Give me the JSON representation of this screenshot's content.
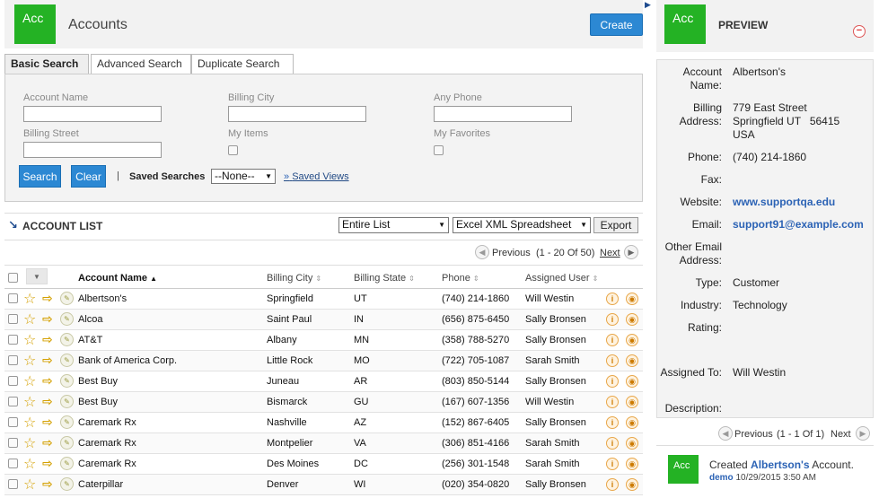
{
  "header": {
    "logo_text": "Acc",
    "title": "Accounts",
    "create_label": "Create"
  },
  "search": {
    "tabs": [
      "Basic Search",
      "Advanced Search",
      "Duplicate Search"
    ],
    "fields": {
      "account_name": "Account Name",
      "billing_city": "Billing City",
      "any_phone": "Any Phone",
      "billing_street": "Billing Street",
      "my_items": "My Items",
      "my_favorites": "My Favorites"
    },
    "search_label": "Search",
    "clear_label": "Clear",
    "separator": "|",
    "saved_searches_label": "Saved Searches",
    "saved_searches_value": "--None--",
    "saved_views_label": "Saved Views"
  },
  "list": {
    "title": "ACCOUNT LIST",
    "scope_value": "Entire List",
    "format_value": "Excel XML Spreadsheet",
    "export_label": "Export",
    "pager": {
      "previous": "Previous",
      "range": "(1 - 20 Of 50)",
      "next": "Next"
    },
    "columns": [
      "Account Name",
      "Billing City",
      "Billing State",
      "Phone",
      "Assigned User"
    ],
    "rows": [
      [
        "Albertson's",
        "Springfield",
        "UT",
        "(740) 214-1860",
        "Will Westin"
      ],
      [
        "Alcoa",
        "Saint Paul",
        "IN",
        "(656) 875-6450",
        "Sally Bronsen"
      ],
      [
        "AT&T",
        "Albany",
        "MN",
        "(358) 788-5270",
        "Sally Bronsen"
      ],
      [
        "Bank of America Corp.",
        "Little Rock",
        "MO",
        "(722) 705-1087",
        "Sarah Smith"
      ],
      [
        "Best Buy",
        "Juneau",
        "AR",
        "(803) 850-5144",
        "Sally Bronsen"
      ],
      [
        "Best Buy",
        "Bismarck",
        "GU",
        "(167) 607-1356",
        "Will Westin"
      ],
      [
        "Caremark Rx",
        "Nashville",
        "AZ",
        "(152) 867-6405",
        "Sally Bronsen"
      ],
      [
        "Caremark Rx",
        "Montpelier",
        "VA",
        "(306) 851-4166",
        "Sarah Smith"
      ],
      [
        "Caremark Rx",
        "Des Moines",
        "DC",
        "(256) 301-1548",
        "Sarah Smith"
      ],
      [
        "Caterpillar",
        "Denver",
        "WI",
        "(020) 354-0820",
        "Sally Bronsen"
      ]
    ]
  },
  "preview": {
    "logo_text": "Acc",
    "title": "PREVIEW",
    "labels": {
      "account_name": "Account Name:",
      "billing_address": "Billing Address:",
      "phone": "Phone:",
      "fax": "Fax:",
      "website": "Website:",
      "email": "Email:",
      "other_email": "Other Email Address:",
      "type": "Type:",
      "industry": "Industry:",
      "rating": "Rating:",
      "assigned_to": "Assigned To:",
      "description": "Description:"
    },
    "values": {
      "account_name": "Albertson's",
      "address_line1": "779 East Street",
      "address_line2": "Springfield UT   56415",
      "address_line3": "USA",
      "phone": "(740) 214-1860",
      "website": "www.supportqa.edu",
      "email": "support91@example.com",
      "type": "Customer",
      "industry": "Technology",
      "assigned_to": "Will Westin"
    },
    "pager": {
      "previous": "Previous",
      "range": "(1 - 1 Of 1)",
      "next": "Next"
    },
    "feed": {
      "logo_text": "Acc",
      "prefix": "Created",
      "account": "Albertson's",
      "suffix": "Account.",
      "user": "demo",
      "timestamp": "10/29/2015 3:50 AM"
    }
  },
  "colors": {
    "brand_green": "#24b224",
    "primary_blue": "#2c88d3",
    "link_blue": "#2c63b5",
    "accent_orange": "#cc7a00"
  }
}
